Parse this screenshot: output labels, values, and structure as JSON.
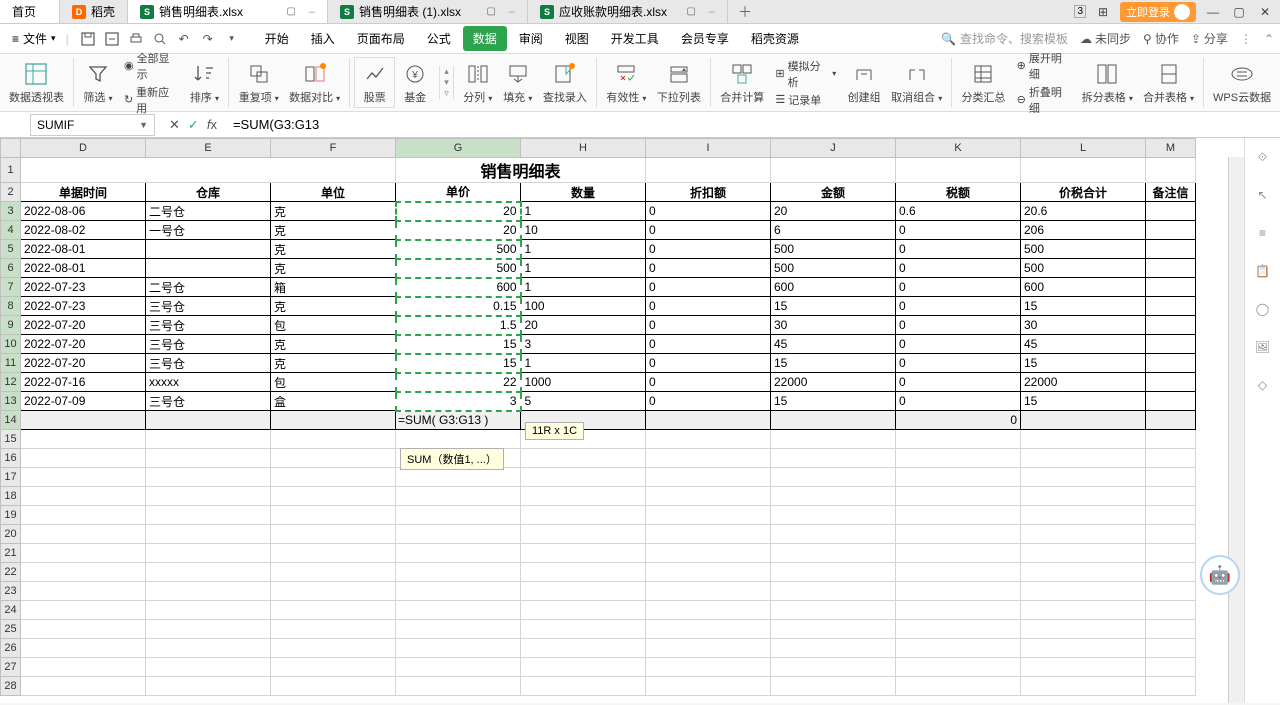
{
  "tabs": {
    "home": "首页",
    "t1": "稻壳",
    "t2": "销售明细表.xlsx",
    "t3": "销售明细表 (1).xlsx",
    "t4": "应收账款明细表.xlsx",
    "login": "立即登录",
    "num_indicator": "3"
  },
  "menu": {
    "file": "文件",
    "items": [
      "开始",
      "插入",
      "页面布局",
      "公式",
      "数据",
      "审阅",
      "视图",
      "开发工具",
      "会员专享",
      "稻壳资源"
    ],
    "search_placeholder": "查找命令、搜索模板",
    "unsync": "未同步",
    "collab": "协作",
    "share": "分享"
  },
  "ribbon": {
    "pivot": "数据透视表",
    "filter": "筛选",
    "show_all": "全部显示",
    "reapply": "重新应用",
    "sort": "排序",
    "dup": "重复项",
    "compare": "数据对比",
    "stock": "股票",
    "fund": "基金",
    "split": "分列",
    "fill": "填充",
    "lookup": "查找录入",
    "validity": "有效性",
    "dropdown": "下拉列表",
    "consolidate": "合并计算",
    "simulate": "模拟分析",
    "record": "记录单",
    "group": "创建组",
    "ungroup": "取消组合",
    "subtotal": "分类汇总",
    "expand": "展开明细",
    "collapse": "折叠明细",
    "split_table": "拆分表格",
    "merge_table": "合并表格",
    "cloud": "WPS云数据"
  },
  "formula_bar": {
    "name_box": "SUMIF",
    "formula": "=SUM(G3:G13"
  },
  "sheet": {
    "columns": [
      "D",
      "E",
      "F",
      "G",
      "H",
      "I",
      "J",
      "K",
      "L",
      "M"
    ],
    "widths": [
      125,
      125,
      125,
      125,
      125,
      125,
      125,
      125,
      125,
      50
    ],
    "title": "销售明细表",
    "headers": [
      "单据时间",
      "仓库",
      "单位",
      "单价",
      "数量",
      "折扣额",
      "金额",
      "税额",
      "价税合计",
      "备注信"
    ],
    "rows": [
      {
        "d": "2022-08-06",
        "e": "二号仓",
        "f": "克",
        "g": "20",
        "h": "1",
        "i": "0",
        "j": "20",
        "k": "0.6",
        "l": "20.6"
      },
      {
        "d": "2022-08-02",
        "e": "一号仓",
        "f": "克",
        "g": "20",
        "h": "10",
        "i": "0",
        "j": "6",
        "k": "0",
        "l": "206"
      },
      {
        "d": "2022-08-01",
        "e": "",
        "f": "克",
        "g": "500",
        "h": "1",
        "i": "0",
        "j": "500",
        "k": "0",
        "l": "500"
      },
      {
        "d": "2022-08-01",
        "e": "",
        "f": "克",
        "g": "500",
        "h": "1",
        "i": "0",
        "j": "500",
        "k": "0",
        "l": "500"
      },
      {
        "d": "2022-07-23",
        "e": "二号仓",
        "f": "箱",
        "g": "600",
        "h": "1",
        "i": "0",
        "j": "600",
        "k": "0",
        "l": "600"
      },
      {
        "d": "2022-07-23",
        "e": "三号仓",
        "f": "克",
        "g": "0.15",
        "h": "100",
        "i": "0",
        "j": "15",
        "k": "0",
        "l": "15"
      },
      {
        "d": "2022-07-20",
        "e": "三号仓",
        "f": "包",
        "g": "1.5",
        "h": "20",
        "i": "0",
        "j": "30",
        "k": "0",
        "l": "30"
      },
      {
        "d": "2022-07-20",
        "e": "三号仓",
        "f": "克",
        "g": "15",
        "h": "3",
        "i": "0",
        "j": "45",
        "k": "0",
        "l": "45"
      },
      {
        "d": "2022-07-20",
        "e": "三号仓",
        "f": "克",
        "g": "15",
        "h": "1",
        "i": "0",
        "j": "15",
        "k": "0",
        "l": "15"
      },
      {
        "d": "2022-07-16",
        "e": "xxxxx",
        "f": "包",
        "g": "22",
        "h": "1000",
        "i": "0",
        "j": "22000",
        "k": "0",
        "l": "22000"
      },
      {
        "d": "2022-07-09",
        "e": "三号仓",
        "f": "盒",
        "g": "3",
        "h": "5",
        "i": "0",
        "j": "15",
        "k": "0",
        "l": "15"
      }
    ],
    "active_row_k": "0",
    "edit_cell_value": "=SUM( G3:G13 )",
    "selection_tip": "11R x 1C",
    "formula_tip": "SUM（数值1, ...）"
  }
}
